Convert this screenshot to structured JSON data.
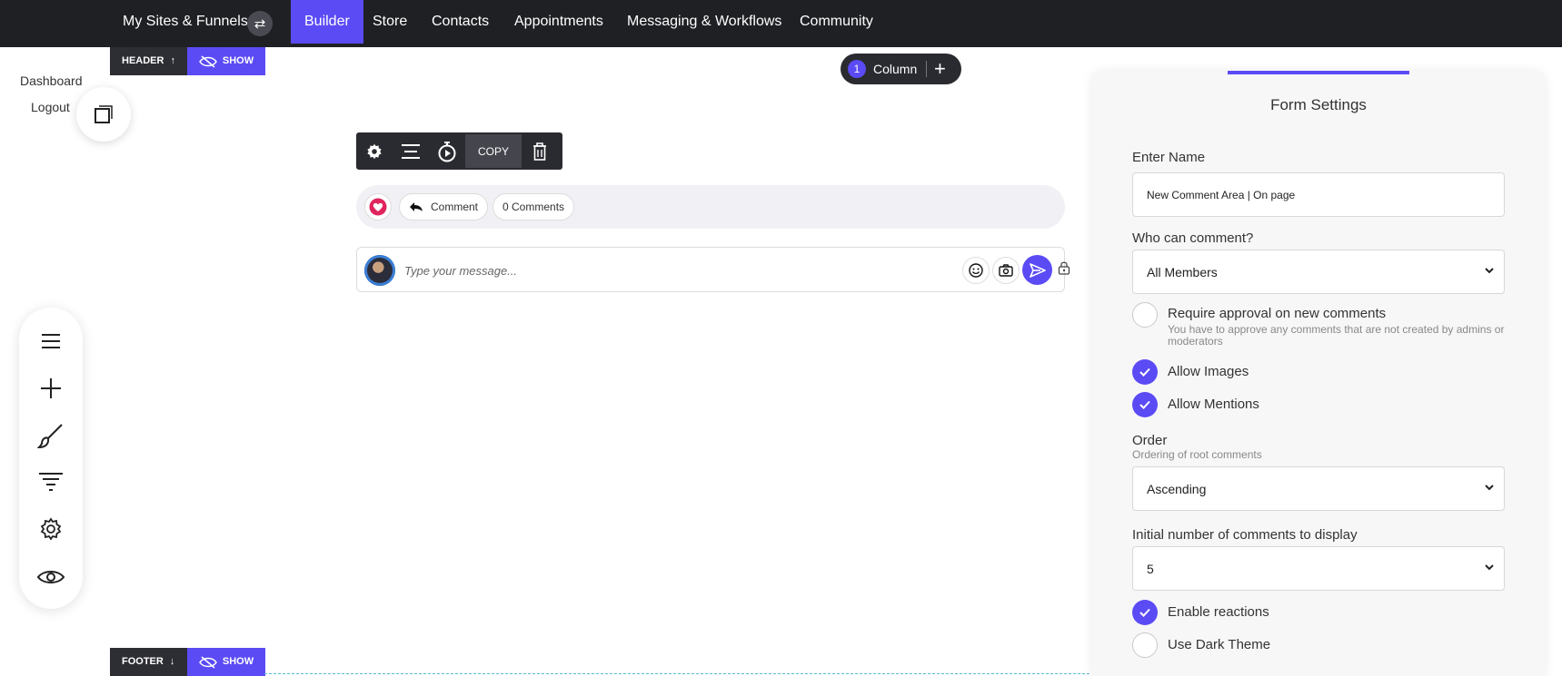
{
  "topnav": {
    "brand": "My Sites & Funnels",
    "items": [
      {
        "label": "Builder",
        "active": true
      },
      {
        "label": "Store",
        "active": false
      },
      {
        "label": "Contacts",
        "active": false
      },
      {
        "label": "Appointments",
        "active": false
      },
      {
        "label": "Messaging & Workflows",
        "active": false
      },
      {
        "label": "Community",
        "active": false
      }
    ]
  },
  "left_links": {
    "dashboard": "Dashboard",
    "logout": "Logout"
  },
  "tool_rail": {
    "tools": [
      "menu-icon",
      "plus-icon",
      "brush-icon",
      "filter-icon",
      "gear-icon",
      "eye-icon"
    ]
  },
  "header_tag": {
    "label": "HEADER",
    "arrow": "↑",
    "show": "SHOW"
  },
  "footer_tag": {
    "label": "FOOTER",
    "arrow": "↓",
    "show": "SHOW"
  },
  "column_pill": {
    "count": "1",
    "label": "Column"
  },
  "element_toolbar": {
    "copy_label": "COPY"
  },
  "reactions": {
    "comment_label": "Comment",
    "comments_count": "0 Comments"
  },
  "message": {
    "placeholder": "Type your message..."
  },
  "settings": {
    "title": "Form Settings",
    "name_label": "Enter Name",
    "name_value": "New Comment Area | On page",
    "who_label": "Who can comment?",
    "who_value": "All Members",
    "approval_label": "Require approval on new comments",
    "approval_help": "You have to approve any comments that are not created by admins or moderators",
    "approval_checked": false,
    "images_label": "Allow Images",
    "images_checked": true,
    "mentions_label": "Allow Mentions",
    "mentions_checked": true,
    "order_label": "Order",
    "order_help": "Ordering of root comments",
    "order_value": "Ascending",
    "initial_label": "Initial number of comments to display",
    "initial_value": "5",
    "reactions_label": "Enable reactions",
    "reactions_checked": true,
    "dark_label": "Use Dark Theme",
    "dark_checked": false
  },
  "colors": {
    "accent": "#5b4bf5",
    "topbar": "#1f2024",
    "heart": "#e0245e"
  }
}
